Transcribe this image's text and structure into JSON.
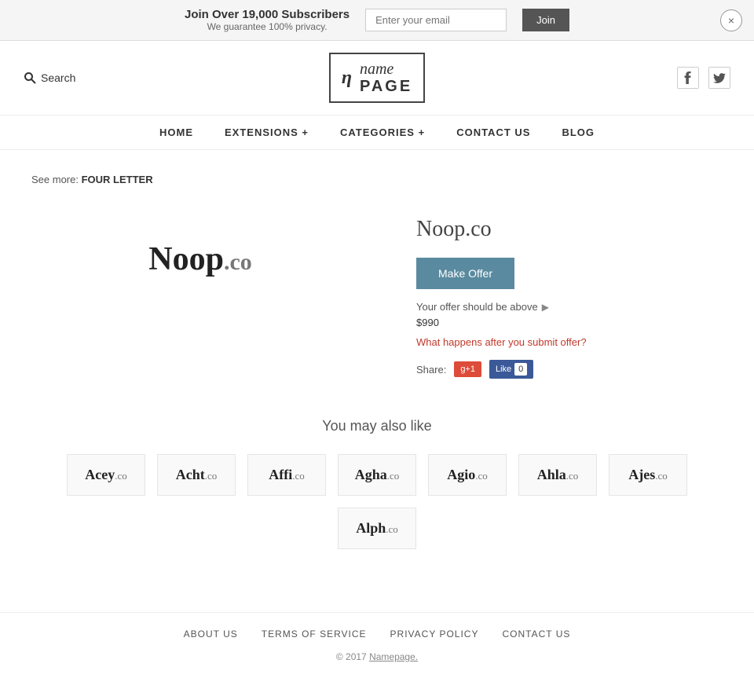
{
  "banner": {
    "headline": "Join Over 19,000 Subscribers",
    "subtext": "We guarantee 100% privacy.",
    "email_placeholder": "Enter your email",
    "join_label": "Join",
    "close_label": "×"
  },
  "header": {
    "search_label": "Search",
    "logo_icon": "η",
    "logo_name": "name",
    "logo_page": "PAGE",
    "facebook_icon": "f",
    "twitter_icon": "t"
  },
  "nav": {
    "items": [
      {
        "label": "HOME"
      },
      {
        "label": "EXTENSIONS +"
      },
      {
        "label": "CATEGORIES +"
      },
      {
        "label": "CONTACT  US"
      },
      {
        "label": "BLOG"
      }
    ]
  },
  "breadcrumb": {
    "prefix": "See more:",
    "link": "FOUR LETTER"
  },
  "domain": {
    "name": "Noop",
    "tld": ".co",
    "full": "Noop.co",
    "make_offer_label": "Make Offer",
    "offer_hint": "Your offer should be above",
    "offer_price": "$990",
    "offer_question": "What happens after you submit offer?",
    "share_label": "Share:",
    "gplus_label": "g+1",
    "fb_like_label": "Like",
    "fb_count": "0"
  },
  "also_like": {
    "title": "You may also like",
    "domains": [
      {
        "name": "Acey",
        "tld": ".co"
      },
      {
        "name": "Acht",
        "tld": ".co"
      },
      {
        "name": "Affi",
        "tld": ".co"
      },
      {
        "name": "Agha",
        "tld": ".co"
      },
      {
        "name": "Agio",
        "tld": ".co"
      },
      {
        "name": "Ahla",
        "tld": ".co"
      },
      {
        "name": "Ajes",
        "tld": ".co"
      },
      {
        "name": "Alph",
        "tld": ".co"
      }
    ]
  },
  "footer": {
    "links": [
      {
        "label": "ABOUT  US"
      },
      {
        "label": "TERMS  OF  SERVICE"
      },
      {
        "label": "PRIVACY  POLICY"
      },
      {
        "label": "CONTACT  US"
      }
    ],
    "copyright": "© 2017",
    "brand": "Namepage."
  }
}
